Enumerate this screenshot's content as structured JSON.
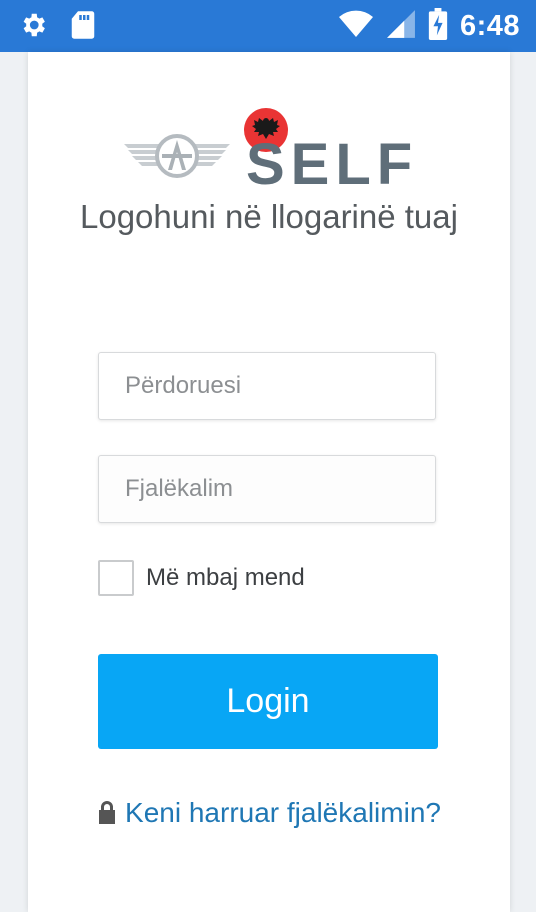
{
  "status_bar": {
    "time": "6:48",
    "icons": [
      "gear-icon",
      "sd-card-icon",
      "wifi-icon",
      "signal-icon",
      "battery-charging-icon"
    ],
    "color": "#2979d6"
  },
  "logo": {
    "wordmark": "SELF",
    "badge_color": "#e93434"
  },
  "heading": "Logohuni në llogarinë tuaj",
  "form": {
    "username_placeholder": "Përdoruesi",
    "password_placeholder": "Fjalëkalim",
    "remember_label": "Më mbaj mend",
    "remember_checked": false,
    "login_label": "Login",
    "login_color": "#08a6f5"
  },
  "forgot_link": {
    "text": "Keni harruar fjalëkalimin?",
    "icon": "lock-icon",
    "color": "#1f77b4"
  }
}
